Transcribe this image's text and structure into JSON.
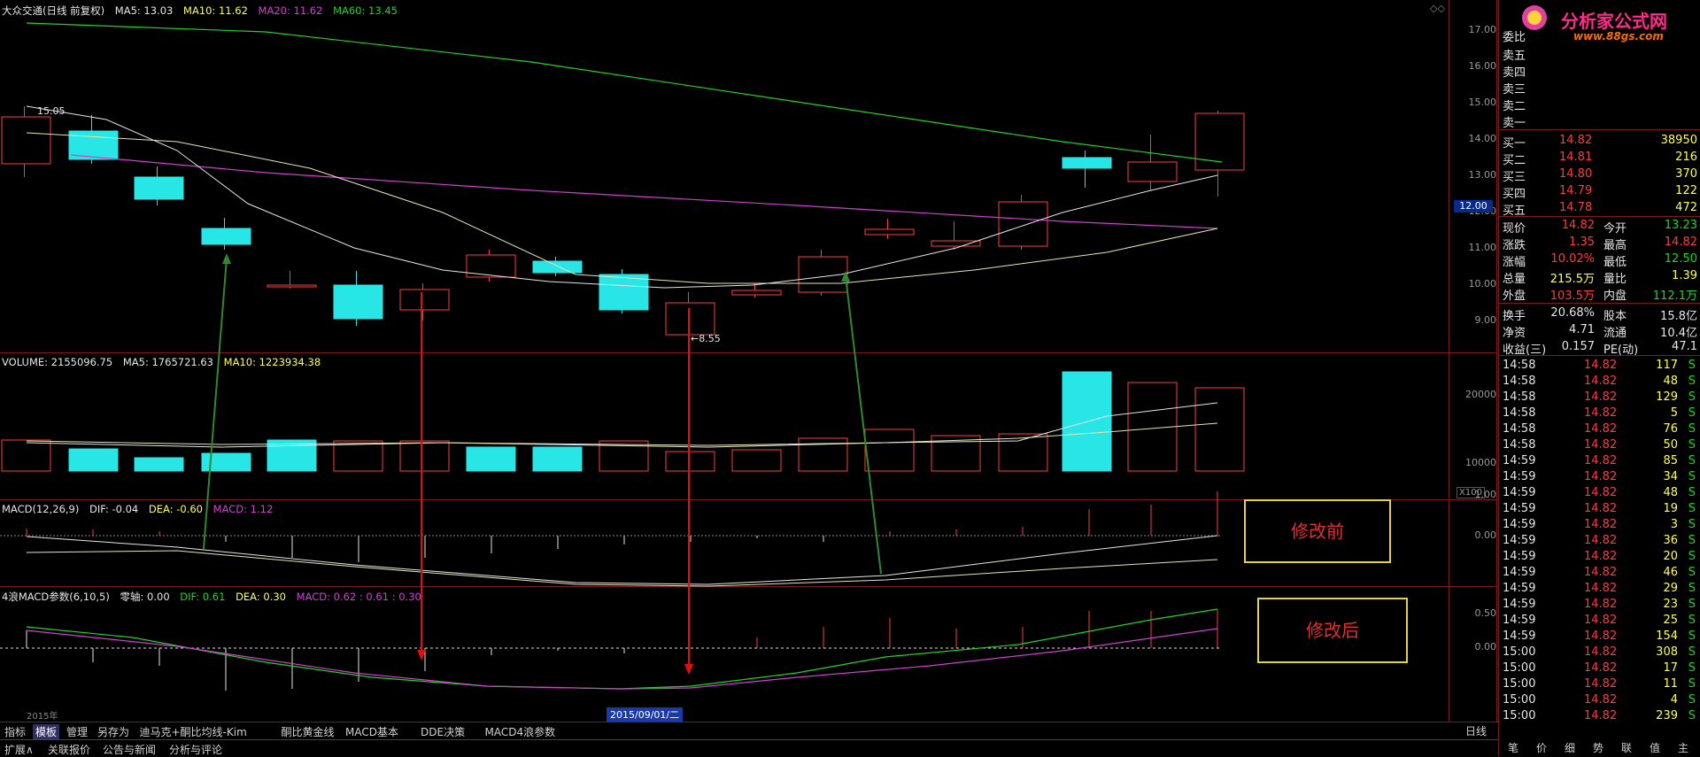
{
  "main_panel": {
    "stock_label": "大众交通(日线 前复权)",
    "ma5": "MA5: 13.03",
    "ma10": "MA10: 11.62",
    "ma20": "MA20: 11.62",
    "ma60": "MA60: 13.45",
    "price_axis": [
      "17.00",
      "16.00",
      "15.00",
      "14.00",
      "13.00",
      "12.00",
      "11.00",
      "10.00",
      "9.00"
    ],
    "high_note": "15.05",
    "low_note": "8.55",
    "current_price_tag": "12.00"
  },
  "volume_panel": {
    "label": "VOLUME: 2155096.75",
    "ma5": "MA5: 1765721.63",
    "ma10": "MA10: 1223934.38",
    "axis": [
      "20000",
      "10000"
    ],
    "unit": "X100"
  },
  "macd_panel": {
    "label": "MACD(12,26,9)",
    "dif": "DIF: -0.04",
    "dea": "DEA: -0.60",
    "macd": "MACD: 1.12",
    "axis": [
      "1.00",
      "0.00"
    ]
  },
  "macd4_panel": {
    "label": "4浪MACD参数(6,10,5)",
    "zero": "零轴: 0.00",
    "dif": "DIF: 0.61",
    "dea": "DEA: 0.30",
    "macd": "MACD: 0.62 : 0.61 : 0.30",
    "axis": [
      "0.50",
      "0.00"
    ]
  },
  "x_axis": {
    "year_label": "2015年",
    "cursor_date": "2015/09/01/二"
  },
  "annotations": {
    "before": "修改前",
    "after": "修改后"
  },
  "tabs_row1": [
    "指标",
    "模板",
    "管理",
    "另存为",
    "迪马克+酮比均线-Kim",
    "酮比黄金线",
    "MACD基本",
    "DDE决策",
    "MACD4浪参数"
  ],
  "tabs_row1_active": "模板",
  "tabs_row2": [
    "扩展∧",
    "关联报价",
    "公告与新闻",
    "分析与评论"
  ],
  "period_label": "日线",
  "logo": {
    "name": "分析家公式网",
    "url": "www.88gs.com"
  },
  "order_book": {
    "wei_label": "委比",
    "sells": [
      "卖五",
      "卖四",
      "卖三",
      "卖二",
      "卖一"
    ],
    "buys": [
      {
        "label": "买一",
        "price": "14.82",
        "vol": "38950"
      },
      {
        "label": "买二",
        "price": "14.81",
        "vol": "216"
      },
      {
        "label": "买三",
        "price": "14.80",
        "vol": "370"
      },
      {
        "label": "买四",
        "price": "14.79",
        "vol": "122"
      },
      {
        "label": "买五",
        "price": "14.78",
        "vol": "472"
      }
    ]
  },
  "quote": [
    {
      "l1": "现价",
      "v1": "14.82",
      "l2": "今开",
      "v2": "13.23"
    },
    {
      "l1": "涨跌",
      "v1": "1.35",
      "l2": "最高",
      "v2": "14.82"
    },
    {
      "l1": "涨幅",
      "v1": "10.02%",
      "l2": "最低",
      "v2": "12.50"
    },
    {
      "l1": "总量",
      "v1": "215.5万",
      "l2": "量比",
      "v2": "1.39"
    },
    {
      "l1": "外盘",
      "v1": "103.5万",
      "l2": "内盘",
      "v2": "112.1万"
    }
  ],
  "stats": [
    {
      "l1": "换手",
      "v1": "20.68%",
      "l2": "股本",
      "v2": "15.8亿"
    },
    {
      "l1": "净资",
      "v1": "4.71",
      "l2": "流通",
      "v2": "10.4亿"
    },
    {
      "l1": "收益(三)",
      "v1": "0.157",
      "l2": "PE(动)",
      "v2": "47.1"
    }
  ],
  "ticks": [
    {
      "t": "14:58",
      "p": "14.82",
      "v": "117",
      "s": "S"
    },
    {
      "t": "14:58",
      "p": "14.82",
      "v": "48",
      "s": "S"
    },
    {
      "t": "14:58",
      "p": "14.82",
      "v": "129",
      "s": "S"
    },
    {
      "t": "14:58",
      "p": "14.82",
      "v": "5",
      "s": "S"
    },
    {
      "t": "14:58",
      "p": "14.82",
      "v": "76",
      "s": "S"
    },
    {
      "t": "14:58",
      "p": "14.82",
      "v": "50",
      "s": "S"
    },
    {
      "t": "14:59",
      "p": "14.82",
      "v": "85",
      "s": "S"
    },
    {
      "t": "14:59",
      "p": "14.82",
      "v": "34",
      "s": "S"
    },
    {
      "t": "14:59",
      "p": "14.82",
      "v": "48",
      "s": "S"
    },
    {
      "t": "14:59",
      "p": "14.82",
      "v": "19",
      "s": "S"
    },
    {
      "t": "14:59",
      "p": "14.82",
      "v": "3",
      "s": "S"
    },
    {
      "t": "14:59",
      "p": "14.82",
      "v": "36",
      "s": "S"
    },
    {
      "t": "14:59",
      "p": "14.82",
      "v": "20",
      "s": "S"
    },
    {
      "t": "14:59",
      "p": "14.82",
      "v": "46",
      "s": "S"
    },
    {
      "t": "14:59",
      "p": "14.82",
      "v": "29",
      "s": "S"
    },
    {
      "t": "14:59",
      "p": "14.82",
      "v": "23",
      "s": "S"
    },
    {
      "t": "14:59",
      "p": "14.82",
      "v": "25",
      "s": "S"
    },
    {
      "t": "14:59",
      "p": "14.82",
      "v": "154",
      "s": "S"
    },
    {
      "t": "15:00",
      "p": "14.82",
      "v": "308",
      "s": "S"
    },
    {
      "t": "15:00",
      "p": "14.82",
      "v": "17",
      "s": "S"
    },
    {
      "t": "15:00",
      "p": "14.82",
      "v": "11",
      "s": "S"
    },
    {
      "t": "15:00",
      "p": "14.82",
      "v": "4",
      "s": "S"
    },
    {
      "t": "15:00",
      "p": "14.82",
      "v": "239",
      "s": "S"
    }
  ],
  "right_bottom_tabs": [
    "笔",
    "价",
    "细",
    "势",
    "联",
    "值",
    "主"
  ],
  "colors": {
    "up": "#ff3b3b",
    "down": "#28e6e6",
    "ma5": "#e6e6e6",
    "ma10": "#ffff54",
    "ma20": "#d040d0",
    "ma60": "#21d421",
    "border": "#7a1c1c"
  }
}
